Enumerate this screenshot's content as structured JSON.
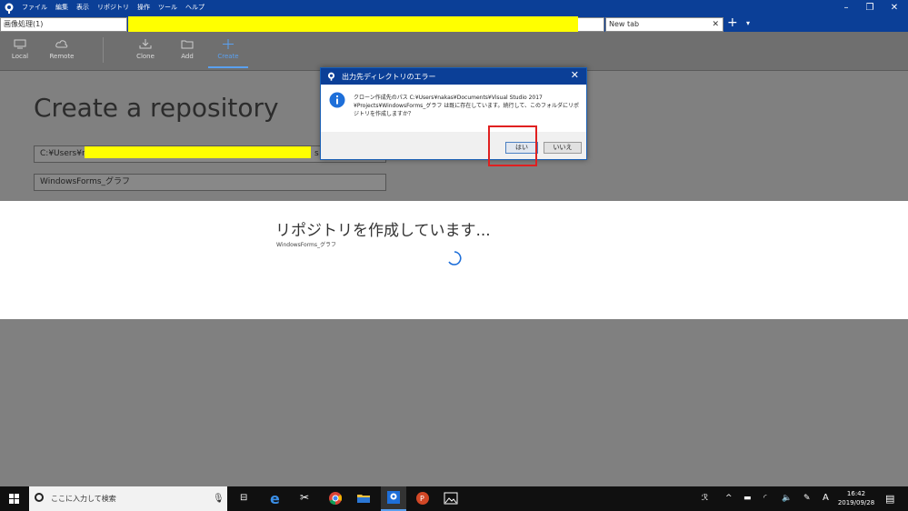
{
  "app": {
    "menu": [
      "ファイル",
      "編集",
      "表示",
      "リポジトリ",
      "操作",
      "ツール",
      "ヘルプ"
    ],
    "window_controls": {
      "minimize": "–",
      "restore": "❐",
      "close": "✕"
    }
  },
  "tabs": {
    "active": "画像処理(1)",
    "new_tab": "New tab",
    "close": "✕",
    "add": "+",
    "dropdown": "▾"
  },
  "toolbar": {
    "items": [
      {
        "label": "Local",
        "icon": "computer-icon"
      },
      {
        "label": "Remote",
        "icon": "cloud-icon"
      },
      {
        "label": "Clone",
        "icon": "download-icon"
      },
      {
        "label": "Add",
        "icon": "folder-icon"
      },
      {
        "label": "Create",
        "icon": "plus-icon"
      }
    ]
  },
  "main": {
    "title": "Create a repository",
    "path_value_prefix": "C:¥Users¥n",
    "path_value_suffix": "s",
    "name_value": "WindowsForms_グラフ"
  },
  "progress": {
    "title": "リポジトリを作成しています...",
    "subtitle": "WindowsForms_グラフ"
  },
  "dialog": {
    "title": "出力先ディレクトリのエラー",
    "message": "クローン作成先のパス C:¥Users¥nakas¥Documents¥Visual Studio 2017 ¥Projects¥WindowsForms_グラフ は既に存在しています。続行して、このフォルダにリポジトリを作成しますか？",
    "yes": "はい",
    "no": "いいえ",
    "close": "✕"
  },
  "taskbar": {
    "search_placeholder": "ここに入力して検索",
    "time": "16:42",
    "date": "2019/09/28",
    "ime": "A"
  },
  "colors": {
    "titlebar": "#0b3f97",
    "highlight": "#ffff00",
    "annotation_box": "#e02020"
  }
}
